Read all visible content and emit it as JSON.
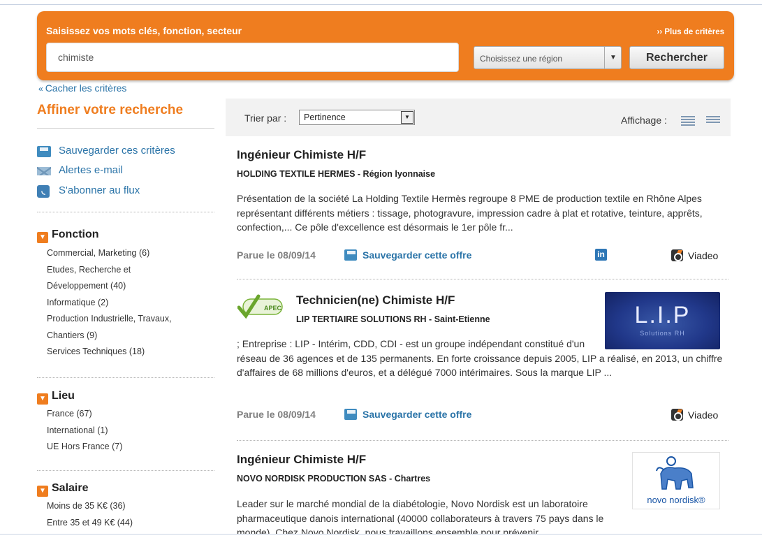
{
  "search": {
    "title": "Saisissez vos mots clés, fonction, secteur",
    "more_criteria": "›› Plus de critères",
    "keyword_value": "chimiste",
    "region_placeholder": "Choisissez une région",
    "submit_label": "Rechercher"
  },
  "hide_criteria": "Cacher les critères",
  "sidebar": {
    "title": "Affiner votre recherche",
    "actions": {
      "save": "Sauvegarder ces critères",
      "alerts": "Alertes e-mail",
      "rss": "S'abonner au flux"
    },
    "fonction": {
      "title": "Fonction",
      "items": [
        "Commercial, Marketing (6)",
        "Etudes, Recherche et",
        "Développement (40)",
        "Informatique (2)",
        "Production Industrielle, Travaux,",
        "Chantiers (9)",
        "Services Techniques (18)"
      ]
    },
    "lieu": {
      "title": "Lieu",
      "items": [
        "France (67)",
        "International (1)",
        "UE Hors France (7)"
      ]
    },
    "salaire": {
      "title": "Salaire",
      "items": [
        "Moins de 35 K€ (36)",
        "Entre 35 et 49 K€ (44)"
      ]
    }
  },
  "sortbar": {
    "sort_label": "Trier par :",
    "sort_value": "Pertinence",
    "display_label": "Affichage :"
  },
  "jobs": [
    {
      "title": "Ingénieur Chimiste H/F",
      "company": "HOLDING TEXTILE HERMES - Région lyonnaise",
      "description": "Présentation de la société La Holding Textile Hermès regroupe 8 PME de production textile en Rhône Alpes représentant différents métiers : tissage, photogravure, impression cadre à plat et rotative, teinture, apprêts, confection,... Ce pôle d'excellence est désormais le 1er pôle fr...",
      "date": "Parue le 08/09/14",
      "save": "Sauvegarder cette offre",
      "linkedin": "in",
      "viadeo": "Viadeo"
    },
    {
      "title": "Technicien(ne) Chimiste H/F",
      "company": "LIP TERTIAIRE SOLUTIONS RH - Saint-Etienne",
      "description": "; Entreprise : LIP - Intérim, CDD, CDI - est un groupe indépendant constitué d'un réseau de 36 agences et de 135 permanents. En forte croissance depuis 2005, LIP a réalisé, en 2013, un chiffre d'affaires de 68 millions d'euros, et a délégué 7000 intérimaires. Sous la marque LIP ...",
      "date": "Parue le 08/09/14",
      "save": "Sauvegarder cette offre",
      "viadeo": "Viadeo",
      "apec_label": "APEC",
      "logo_text": "L.I.P",
      "logo_sub": "Solutions RH"
    },
    {
      "title": "Ingénieur Chimiste H/F",
      "company": "NOVO NORDISK PRODUCTION SAS - Chartres",
      "description": "Leader sur le marché mondial de la diabétologie, Novo Nordisk est un laboratoire pharmaceutique danois international (40000 collaborateurs à travers 75 pays dans le monde). Chez Novo Nordisk, nous travaillons ensemble pour prévenir",
      "logo_text": "novo nordisk®"
    }
  ]
}
